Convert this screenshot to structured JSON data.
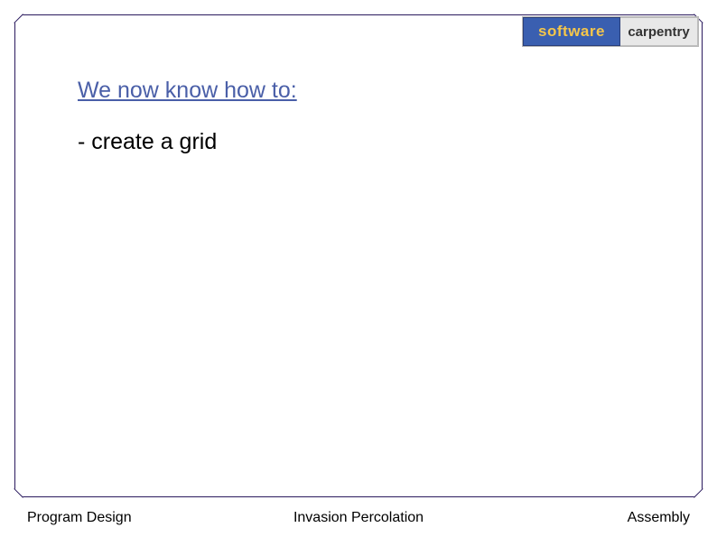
{
  "logo": {
    "left": "software",
    "right": "carpentry"
  },
  "content": {
    "heading": "We now know how to:",
    "bullets": [
      "- create a grid"
    ]
  },
  "footer": {
    "left": "Program Design",
    "center": "Invasion Percolation",
    "right": "Assembly"
  }
}
